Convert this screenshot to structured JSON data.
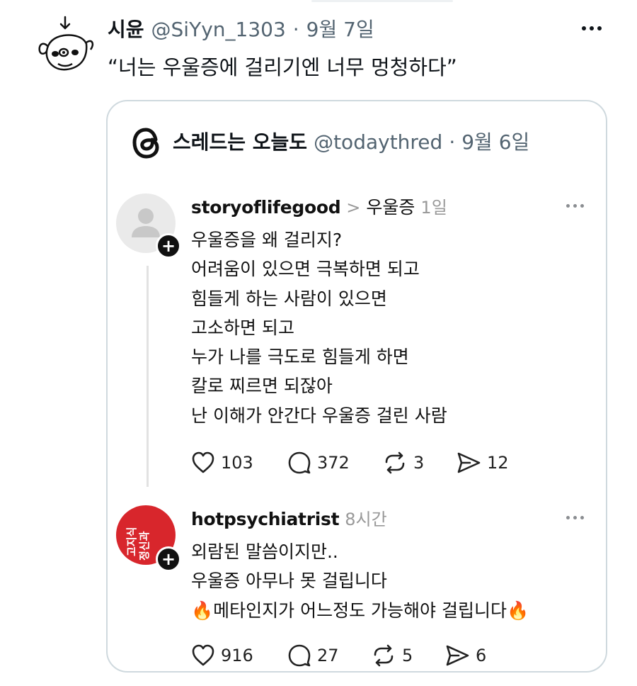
{
  "tweet": {
    "display_name": "시윤",
    "handle": "@SiYyn_1303",
    "separator": "·",
    "date": "9월 7일",
    "text": "“너는 우울증에 걸리기엔 너무 멍청하다”",
    "avatar_icon": "doodle-dog-icon"
  },
  "quote": {
    "display_name": "스레드는 오늘도",
    "handle": "@todaythred",
    "separator": "·",
    "date": "9월 6일",
    "avatar_icon": "threads-logo-icon"
  },
  "posts": [
    {
      "username": "storyoflifegood",
      "tag_arrow": ">",
      "tag": "우울증",
      "time": "1일",
      "lines": [
        "우울증을 왜 걸리지?",
        "어려움이 있으면 극복하면 되고",
        "힘들게 하는 사람이 있으면",
        "고소하면 되고",
        "누가 나를 극도로 힘들게 하면",
        "칼로 찌르면 되잖아",
        "난 이해가 안간다 우울증 걸린 사람"
      ],
      "likes": "103",
      "replies": "372",
      "reposts": "3",
      "shares": "12"
    },
    {
      "username": "hotpsychiatrist",
      "time": "8시간",
      "avatar_text": [
        "고지식",
        "정신과"
      ],
      "lines": [
        "외람된 말씀이지만..",
        "우울증 아무나 못 걸립니다",
        "🔥메타인지가 어느정도 가능해야 걸립니다🔥"
      ],
      "likes": "916",
      "replies": "27",
      "reposts": "5",
      "shares": "6"
    }
  ],
  "colors": {
    "text": "#0f1419",
    "muted": "#536471",
    "card_border": "#cfd9de",
    "avatar_red": "#d8262c"
  }
}
